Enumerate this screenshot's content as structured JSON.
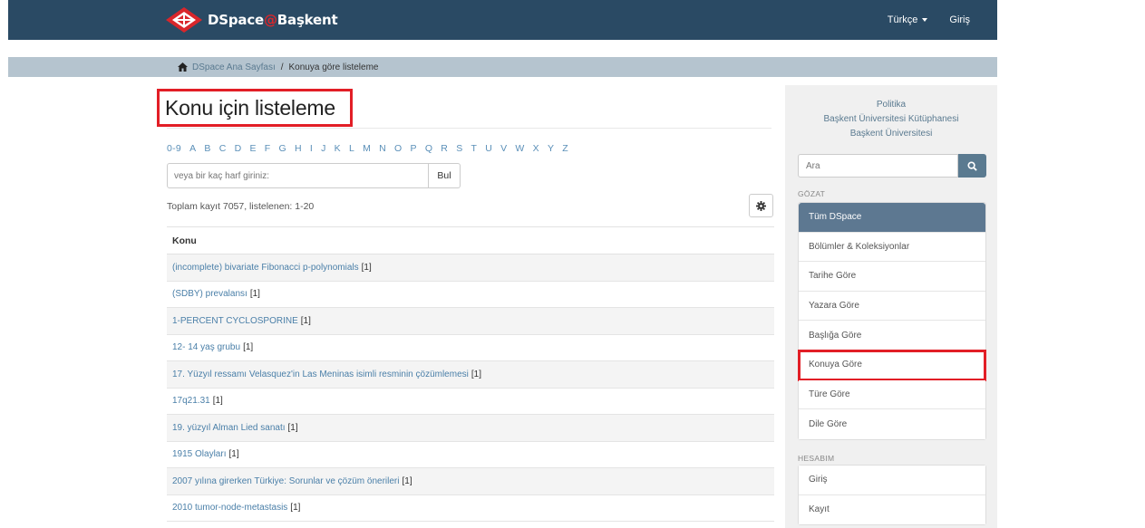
{
  "header": {
    "brand_name": "DSpace",
    "brand_at": "@",
    "brand_site": "Başkent",
    "language_label": "Türkçe",
    "login_label": "Giriş"
  },
  "breadcrumb": {
    "home_icon": "home-icon",
    "home_label": "DSpace Ana Sayfası",
    "separator": "/",
    "current": "Konuya göre listeleme"
  },
  "main": {
    "title": "Konu için listeleme",
    "letters": [
      "0-9",
      "A",
      "B",
      "C",
      "D",
      "E",
      "F",
      "G",
      "H",
      "I",
      "J",
      "K",
      "L",
      "M",
      "N",
      "O",
      "P",
      "Q",
      "R",
      "S",
      "T",
      "U",
      "V",
      "W",
      "X",
      "Y",
      "Z"
    ],
    "search_placeholder": "veya bir kaç harf giriniz:",
    "search_button": "Bul",
    "summary": "Toplam kayıt 7057, listelenen: 1-20",
    "settings_icon": "gear-icon",
    "table_header": "Konu",
    "rows": [
      {
        "subject": "(incomplete) bivariate Fibonacci p-polynomials",
        "count": "[1]"
      },
      {
        "subject": "(SDBY) prevalansı",
        "count": "[1]"
      },
      {
        "subject": "1-PERCENT CYCLOSPORINE",
        "count": "[1]"
      },
      {
        "subject": "12- 14 yaş grubu",
        "count": "[1]"
      },
      {
        "subject": "17. Yüzyıl ressamı Velasquez'in Las Meninas isimli resminin çözümlemesi",
        "count": "[1]"
      },
      {
        "subject": "17q21.31",
        "count": "[1]"
      },
      {
        "subject": "19. yüzyıl Alman Lied sanatı",
        "count": "[1]"
      },
      {
        "subject": "1915 Olayları",
        "count": "[1]"
      },
      {
        "subject": "2007 yılına girerken Türkiye: Sorunlar ve çözüm önerileri",
        "count": "[1]"
      },
      {
        "subject": "2010 tumor-node-metastasis",
        "count": "[1]"
      }
    ]
  },
  "sidebar": {
    "policy_line1": "Politika",
    "policy_line2": "Başkent Üniversitesi Kütüphanesi",
    "policy_line3": "Başkent Üniversitesi",
    "search_placeholder": "Ara",
    "search_icon": "search-icon",
    "browse_label": "GÖZAT",
    "browse_items": [
      "Tüm DSpace",
      "Bölümler & Koleksiyonlar",
      "Tarihe Göre",
      "Yazara Göre",
      "Başlığa Göre",
      "Konuya Göre",
      "Türe Göre",
      "Dile Göre"
    ],
    "account_label": "HESABIM",
    "account_items": [
      "Giriş",
      "Kayıt"
    ]
  },
  "colors": {
    "navbar": "#2a4a64",
    "breadcrumb_bar": "#b5c4cf",
    "link": "#4a7fa8",
    "highlight_box": "#e21e26",
    "active_item": "#5d7891"
  }
}
